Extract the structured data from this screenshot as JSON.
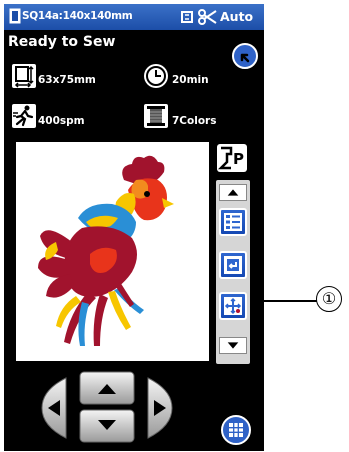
{
  "topbar": {
    "hoop": "SQ14a:140x140mm",
    "mode": "Auto"
  },
  "status": {
    "text": "Ready to Sew"
  },
  "info": {
    "size": "63x75mm",
    "time": "20min",
    "speed": "400spm",
    "colors": "7Colors"
  },
  "callout": {
    "label": "①"
  },
  "icons": {
    "hoop": "hoop-icon",
    "auto_thread": "auto-thread-cutter-icon",
    "return": "return-icon",
    "size": "design-size-icon",
    "time": "clock-icon",
    "speed": "running-speed-icon",
    "colors": "thread-spool-icon",
    "presser": "presser-foot-icon",
    "list": "color-list-icon",
    "jump": "jump-back-icon",
    "move": "move-crosshair-icon",
    "grid": "grid-icon"
  }
}
